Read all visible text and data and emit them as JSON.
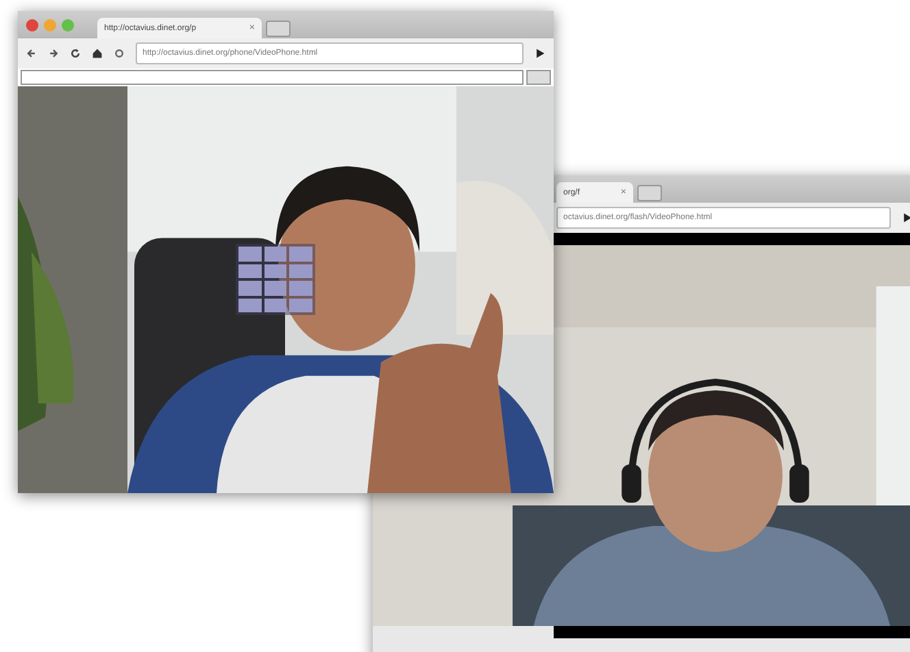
{
  "back_window": {
    "tab_title": "org/f",
    "tab_close": "×",
    "address": "octavius.dinet.org/flash/VideoPhone.html"
  },
  "front_window": {
    "tab_title": "http://octavius.dinet.org/p",
    "tab_close": "×",
    "address": "http://octavius.dinet.org/phone/VideoPhone.html"
  }
}
